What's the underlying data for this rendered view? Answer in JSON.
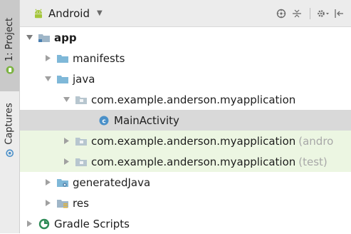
{
  "side_panel": {
    "project_tab": "1: Project",
    "captures_tab": "Captures"
  },
  "toolbar": {
    "view_mode": "Android",
    "caret_icon": "triangle-down",
    "actions": [
      "sync-icon",
      "collapse-all-icon",
      "settings-icon",
      "hide-icon"
    ]
  },
  "tree": [
    {
      "label": "app",
      "bold": true,
      "expanded": true,
      "icon": "module-folder-icon"
    },
    {
      "label": "manifests",
      "expanded": false,
      "icon": "folder-icon"
    },
    {
      "label": "java",
      "expanded": true,
      "icon": "folder-icon"
    },
    {
      "label": "com.example.anderson.myapplication",
      "expanded": true,
      "icon": "package-icon"
    },
    {
      "label": "MainActivity",
      "icon": "class-icon",
      "selected": true
    },
    {
      "label": "com.example.anderson.myapplication",
      "suffix": "(andro",
      "expanded": false,
      "icon": "package-icon"
    },
    {
      "label": "com.example.anderson.myapplication",
      "suffix": "(test)",
      "expanded": false,
      "icon": "package-icon"
    },
    {
      "label": "generatedJava",
      "expanded": false,
      "icon": "generated-folder-icon"
    },
    {
      "label": "res",
      "expanded": false,
      "icon": "res-folder-icon"
    },
    {
      "label": "Gradle Scripts",
      "expanded": false,
      "icon": "gradle-icon"
    }
  ],
  "colors": {
    "folder": "#7fb8d8",
    "android_green": "#a4c639",
    "class_badge": "#4a90c8",
    "selected_row": "#d9d9d9",
    "test_row": "#ecf6e2"
  }
}
